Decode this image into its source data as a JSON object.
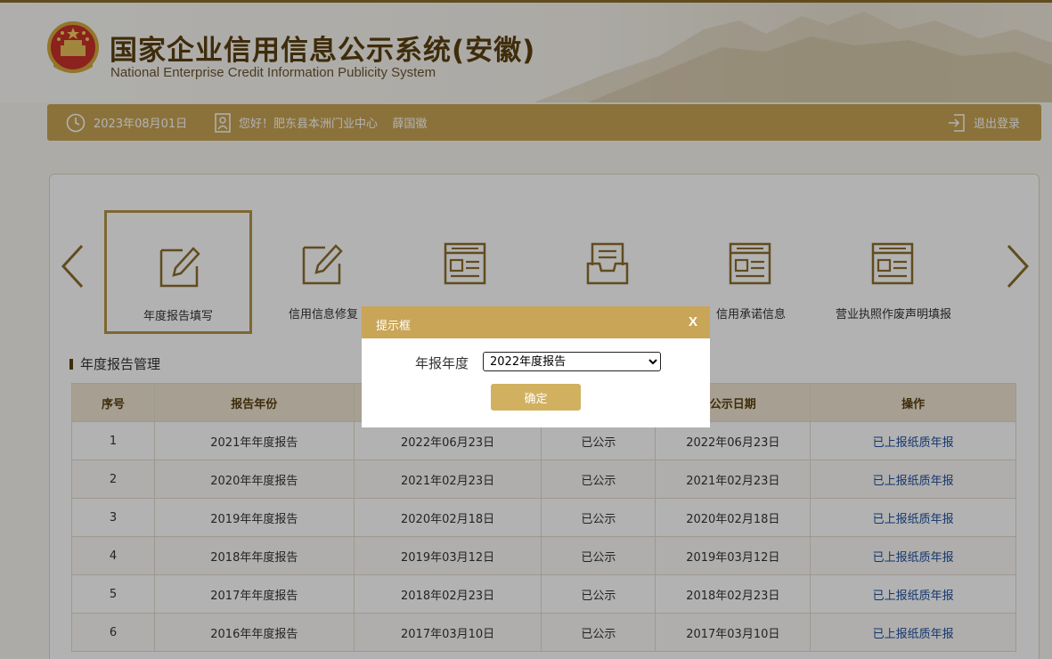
{
  "header": {
    "title": "国家企业信用信息公示系统(安徽)",
    "subtitle": "National Enterprise Credit Information Publicity System",
    "emblem_icon": "national-emblem-icon"
  },
  "infobar": {
    "date": "2023年08月01日",
    "greeting": "您好！肥东县本洲门业中心    薛国徽",
    "logout": "退出登录"
  },
  "tiles": [
    {
      "label": "年度报告填写",
      "icon": "edit-icon",
      "active": true
    },
    {
      "label": "信用信息修复",
      "icon": "edit-icon",
      "active": false
    },
    {
      "label": "",
      "icon": "document-list-icon",
      "active": false
    },
    {
      "label": "",
      "icon": "inbox-icon",
      "active": false
    },
    {
      "label": "信用承诺信息",
      "icon": "document-list-icon",
      "active": false
    },
    {
      "label": "营业执照作废声明填报",
      "icon": "document-list-icon",
      "active": false
    }
  ],
  "section_title": "年度报告管理",
  "table": {
    "headers": [
      "序号",
      "报告年份",
      "",
      "",
      "公示日期",
      "操作"
    ],
    "rows": [
      [
        "1",
        "2021年年度报告",
        "2022年06月23日",
        "已公示",
        "2022年06月23日",
        "已上报纸质年报"
      ],
      [
        "2",
        "2020年年度报告",
        "2021年02月23日",
        "已公示",
        "2021年02月23日",
        "已上报纸质年报"
      ],
      [
        "3",
        "2019年年度报告",
        "2020年02月18日",
        "已公示",
        "2020年02月18日",
        "已上报纸质年报"
      ],
      [
        "4",
        "2018年年度报告",
        "2019年03月12日",
        "已公示",
        "2019年03月12日",
        "已上报纸质年报"
      ],
      [
        "5",
        "2017年年度报告",
        "2018年02月23日",
        "已公示",
        "2018年02月23日",
        "已上报纸质年报"
      ],
      [
        "6",
        "2016年年度报告",
        "2017年03月10日",
        "已公示",
        "2017年03月10日",
        "已上报纸质年报"
      ]
    ]
  },
  "dialog": {
    "title": "提示框",
    "close": "X",
    "field_label": "年报年度",
    "select_value": "2022年度报告",
    "options": [
      "2022年度报告"
    ],
    "confirm": "确定"
  },
  "colors": {
    "gold": "#c7a455",
    "brown": "#5a3f10",
    "link": "#1f4fa0"
  }
}
